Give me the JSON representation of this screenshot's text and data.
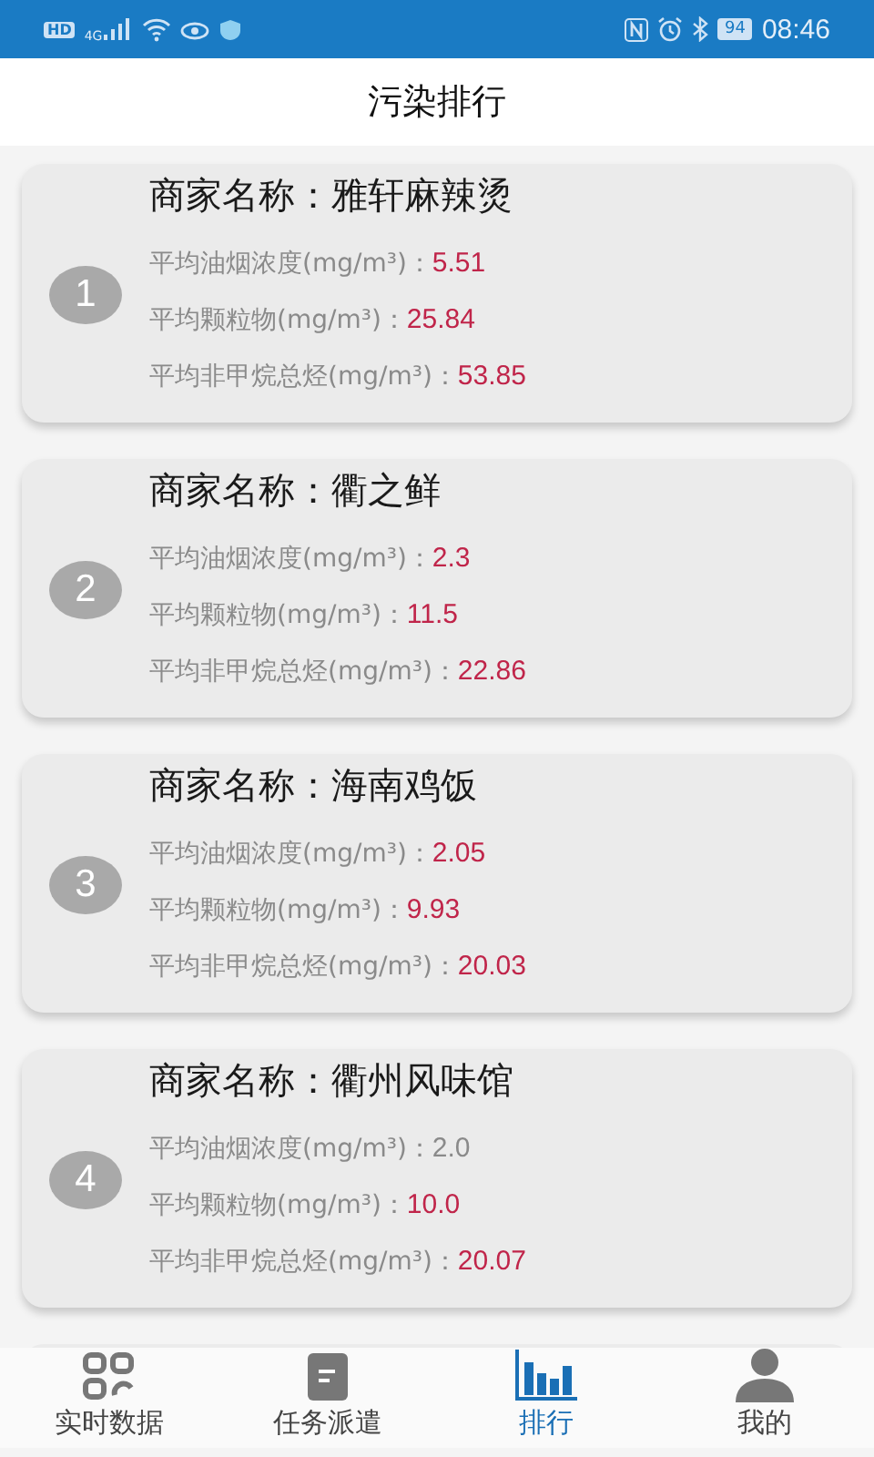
{
  "status_bar": {
    "hd": "HD",
    "network": "4G",
    "battery": "94",
    "time": "08:46"
  },
  "header": {
    "title": "污染排行"
  },
  "ranking": [
    {
      "rank": "1",
      "name": "商家名称：雅轩麻辣烫",
      "metrics": [
        {
          "label": "平均油烟浓度(mg/m³)：",
          "value": "5.51",
          "alert": true
        },
        {
          "label": "平均颗粒物(mg/m³)：",
          "value": "25.84",
          "alert": true
        },
        {
          "label": "平均非甲烷总烃(mg/m³)：",
          "value": "53.85",
          "alert": true
        }
      ]
    },
    {
      "rank": "2",
      "name": "商家名称：衢之鲜",
      "metrics": [
        {
          "label": "平均油烟浓度(mg/m³)：",
          "value": "2.3",
          "alert": true
        },
        {
          "label": "平均颗粒物(mg/m³)：",
          "value": "11.5",
          "alert": true
        },
        {
          "label": "平均非甲烷总烃(mg/m³)：",
          "value": "22.86",
          "alert": true
        }
      ]
    },
    {
      "rank": "3",
      "name": "商家名称：海南鸡饭",
      "metrics": [
        {
          "label": "平均油烟浓度(mg/m³)：",
          "value": "2.05",
          "alert": true
        },
        {
          "label": "平均颗粒物(mg/m³)：",
          "value": "9.93",
          "alert": true
        },
        {
          "label": "平均非甲烷总烃(mg/m³)：",
          "value": "20.03",
          "alert": true
        }
      ]
    },
    {
      "rank": "4",
      "name": "商家名称：衢州风味馆",
      "metrics": [
        {
          "label": "平均油烟浓度(mg/m³)：",
          "value": "2.0",
          "alert": false
        },
        {
          "label": "平均颗粒物(mg/m³)：",
          "value": "10.0",
          "alert": true
        },
        {
          "label": "平均非甲烷总烃(mg/m³)：",
          "value": "20.07",
          "alert": true
        }
      ]
    }
  ],
  "tabs": [
    {
      "label": "实时数据",
      "selected": false
    },
    {
      "label": "任务派遣",
      "selected": false
    },
    {
      "label": "排行",
      "selected": true
    },
    {
      "label": "我的",
      "selected": false
    }
  ]
}
